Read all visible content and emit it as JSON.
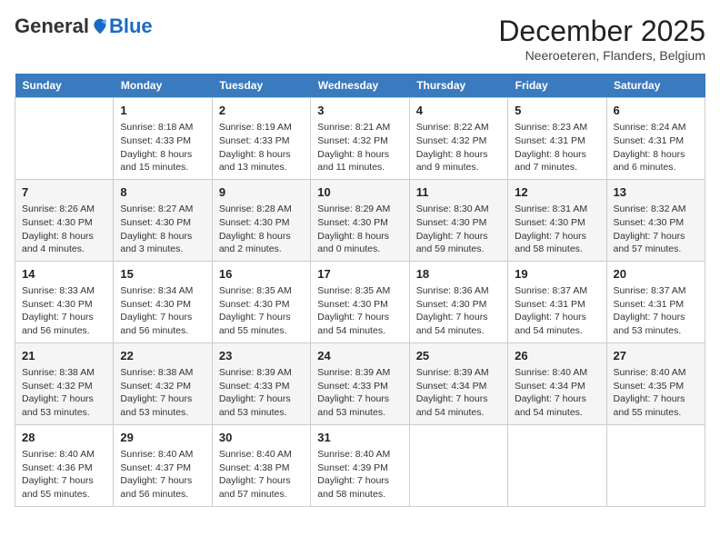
{
  "header": {
    "logo_general": "General",
    "logo_blue": "Blue",
    "month_title": "December 2025",
    "location": "Neeroeteren, Flanders, Belgium"
  },
  "weekdays": [
    "Sunday",
    "Monday",
    "Tuesday",
    "Wednesday",
    "Thursday",
    "Friday",
    "Saturday"
  ],
  "weeks": [
    [
      {
        "day": "",
        "sunrise": "",
        "sunset": "",
        "daylight": ""
      },
      {
        "day": "1",
        "sunrise": "Sunrise: 8:18 AM",
        "sunset": "Sunset: 4:33 PM",
        "daylight": "Daylight: 8 hours and 15 minutes."
      },
      {
        "day": "2",
        "sunrise": "Sunrise: 8:19 AM",
        "sunset": "Sunset: 4:33 PM",
        "daylight": "Daylight: 8 hours and 13 minutes."
      },
      {
        "day": "3",
        "sunrise": "Sunrise: 8:21 AM",
        "sunset": "Sunset: 4:32 PM",
        "daylight": "Daylight: 8 hours and 11 minutes."
      },
      {
        "day": "4",
        "sunrise": "Sunrise: 8:22 AM",
        "sunset": "Sunset: 4:32 PM",
        "daylight": "Daylight: 8 hours and 9 minutes."
      },
      {
        "day": "5",
        "sunrise": "Sunrise: 8:23 AM",
        "sunset": "Sunset: 4:31 PM",
        "daylight": "Daylight: 8 hours and 7 minutes."
      },
      {
        "day": "6",
        "sunrise": "Sunrise: 8:24 AM",
        "sunset": "Sunset: 4:31 PM",
        "daylight": "Daylight: 8 hours and 6 minutes."
      }
    ],
    [
      {
        "day": "7",
        "sunrise": "Sunrise: 8:26 AM",
        "sunset": "Sunset: 4:30 PM",
        "daylight": "Daylight: 8 hours and 4 minutes."
      },
      {
        "day": "8",
        "sunrise": "Sunrise: 8:27 AM",
        "sunset": "Sunset: 4:30 PM",
        "daylight": "Daylight: 8 hours and 3 minutes."
      },
      {
        "day": "9",
        "sunrise": "Sunrise: 8:28 AM",
        "sunset": "Sunset: 4:30 PM",
        "daylight": "Daylight: 8 hours and 2 minutes."
      },
      {
        "day": "10",
        "sunrise": "Sunrise: 8:29 AM",
        "sunset": "Sunset: 4:30 PM",
        "daylight": "Daylight: 8 hours and 0 minutes."
      },
      {
        "day": "11",
        "sunrise": "Sunrise: 8:30 AM",
        "sunset": "Sunset: 4:30 PM",
        "daylight": "Daylight: 7 hours and 59 minutes."
      },
      {
        "day": "12",
        "sunrise": "Sunrise: 8:31 AM",
        "sunset": "Sunset: 4:30 PM",
        "daylight": "Daylight: 7 hours and 58 minutes."
      },
      {
        "day": "13",
        "sunrise": "Sunrise: 8:32 AM",
        "sunset": "Sunset: 4:30 PM",
        "daylight": "Daylight: 7 hours and 57 minutes."
      }
    ],
    [
      {
        "day": "14",
        "sunrise": "Sunrise: 8:33 AM",
        "sunset": "Sunset: 4:30 PM",
        "daylight": "Daylight: 7 hours and 56 minutes."
      },
      {
        "day": "15",
        "sunrise": "Sunrise: 8:34 AM",
        "sunset": "Sunset: 4:30 PM",
        "daylight": "Daylight: 7 hours and 56 minutes."
      },
      {
        "day": "16",
        "sunrise": "Sunrise: 8:35 AM",
        "sunset": "Sunset: 4:30 PM",
        "daylight": "Daylight: 7 hours and 55 minutes."
      },
      {
        "day": "17",
        "sunrise": "Sunrise: 8:35 AM",
        "sunset": "Sunset: 4:30 PM",
        "daylight": "Daylight: 7 hours and 54 minutes."
      },
      {
        "day": "18",
        "sunrise": "Sunrise: 8:36 AM",
        "sunset": "Sunset: 4:30 PM",
        "daylight": "Daylight: 7 hours and 54 minutes."
      },
      {
        "day": "19",
        "sunrise": "Sunrise: 8:37 AM",
        "sunset": "Sunset: 4:31 PM",
        "daylight": "Daylight: 7 hours and 54 minutes."
      },
      {
        "day": "20",
        "sunrise": "Sunrise: 8:37 AM",
        "sunset": "Sunset: 4:31 PM",
        "daylight": "Daylight: 7 hours and 53 minutes."
      }
    ],
    [
      {
        "day": "21",
        "sunrise": "Sunrise: 8:38 AM",
        "sunset": "Sunset: 4:32 PM",
        "daylight": "Daylight: 7 hours and 53 minutes."
      },
      {
        "day": "22",
        "sunrise": "Sunrise: 8:38 AM",
        "sunset": "Sunset: 4:32 PM",
        "daylight": "Daylight: 7 hours and 53 minutes."
      },
      {
        "day": "23",
        "sunrise": "Sunrise: 8:39 AM",
        "sunset": "Sunset: 4:33 PM",
        "daylight": "Daylight: 7 hours and 53 minutes."
      },
      {
        "day": "24",
        "sunrise": "Sunrise: 8:39 AM",
        "sunset": "Sunset: 4:33 PM",
        "daylight": "Daylight: 7 hours and 53 minutes."
      },
      {
        "day": "25",
        "sunrise": "Sunrise: 8:39 AM",
        "sunset": "Sunset: 4:34 PM",
        "daylight": "Daylight: 7 hours and 54 minutes."
      },
      {
        "day": "26",
        "sunrise": "Sunrise: 8:40 AM",
        "sunset": "Sunset: 4:34 PM",
        "daylight": "Daylight: 7 hours and 54 minutes."
      },
      {
        "day": "27",
        "sunrise": "Sunrise: 8:40 AM",
        "sunset": "Sunset: 4:35 PM",
        "daylight": "Daylight: 7 hours and 55 minutes."
      }
    ],
    [
      {
        "day": "28",
        "sunrise": "Sunrise: 8:40 AM",
        "sunset": "Sunset: 4:36 PM",
        "daylight": "Daylight: 7 hours and 55 minutes."
      },
      {
        "day": "29",
        "sunrise": "Sunrise: 8:40 AM",
        "sunset": "Sunset: 4:37 PM",
        "daylight": "Daylight: 7 hours and 56 minutes."
      },
      {
        "day": "30",
        "sunrise": "Sunrise: 8:40 AM",
        "sunset": "Sunset: 4:38 PM",
        "daylight": "Daylight: 7 hours and 57 minutes."
      },
      {
        "day": "31",
        "sunrise": "Sunrise: 8:40 AM",
        "sunset": "Sunset: 4:39 PM",
        "daylight": "Daylight: 7 hours and 58 minutes."
      },
      {
        "day": "",
        "sunrise": "",
        "sunset": "",
        "daylight": ""
      },
      {
        "day": "",
        "sunrise": "",
        "sunset": "",
        "daylight": ""
      },
      {
        "day": "",
        "sunrise": "",
        "sunset": "",
        "daylight": ""
      }
    ]
  ]
}
